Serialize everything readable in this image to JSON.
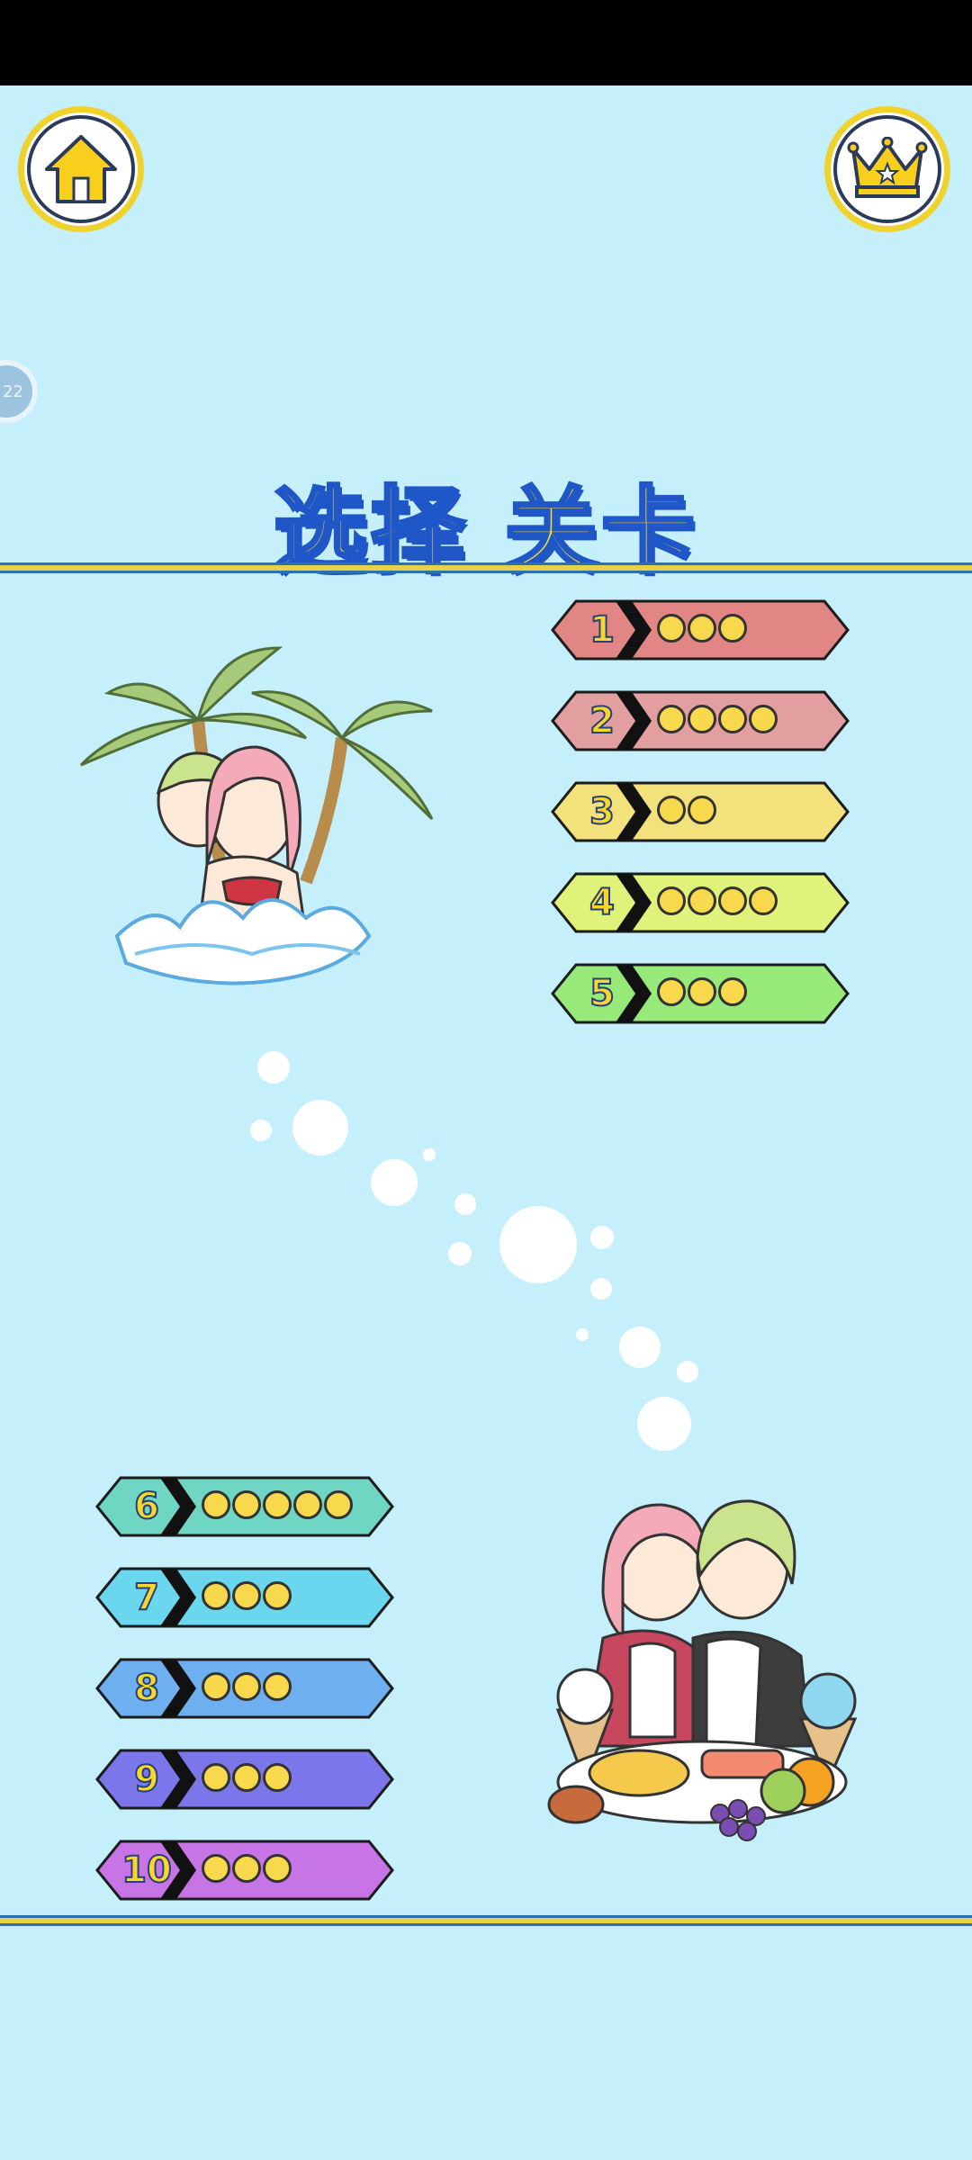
{
  "title": "选择 关卡",
  "side_badge": "22",
  "header": {
    "home_icon": "home-icon",
    "crown_icon": "crown-icon"
  },
  "levels": [
    {
      "number": "1",
      "stars": 3,
      "color": "#e28585"
    },
    {
      "number": "2",
      "stars": 4,
      "color": "#e39f9f"
    },
    {
      "number": "3",
      "stars": 2,
      "color": "#f3e17c"
    },
    {
      "number": "4",
      "stars": 4,
      "color": "#e1f27a"
    },
    {
      "number": "5",
      "stars": 3,
      "color": "#97ea7a"
    },
    {
      "number": "6",
      "stars": 5,
      "color": "#6ed6c2"
    },
    {
      "number": "7",
      "stars": 3,
      "color": "#6ad7ee"
    },
    {
      "number": "8",
      "stars": 3,
      "color": "#6eaff0"
    },
    {
      "number": "9",
      "stars": 3,
      "color": "#7b76ea"
    },
    {
      "number": "10",
      "stars": 3,
      "color": "#c774e6"
    }
  ],
  "colors": {
    "background": "#c4effb",
    "title_fill": "#f8d72c",
    "title_outline": "#1f56c8",
    "divider": "#e6d249"
  }
}
